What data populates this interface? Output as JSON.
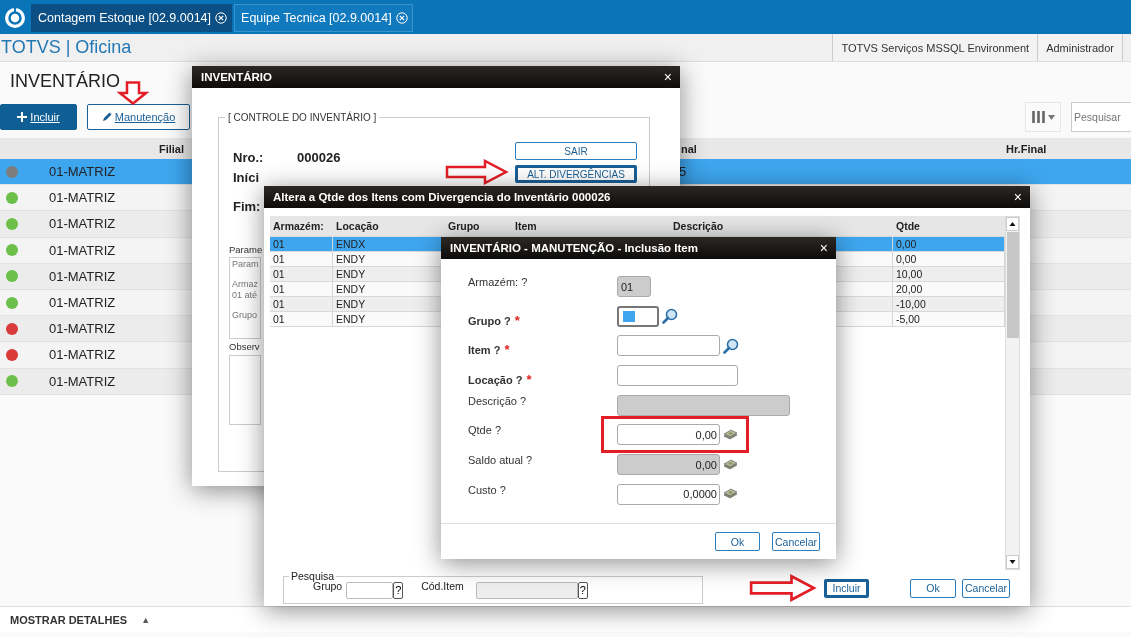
{
  "tabs": [
    {
      "label": "Contagem Estoque [02.9.0014]",
      "selected": true
    },
    {
      "label": "Equipe Tecnica [02.9.0014]",
      "selected": false
    }
  ],
  "app_title": "TOTVS | Oficina",
  "header_links": [
    "TOTVS Serviços MSSQL Environment",
    "Administrador"
  ],
  "page_title": "INVENTÁRIO",
  "toolbar": {
    "buttons": [
      {
        "label": "Incluir",
        "kind": "primary",
        "annotated": false
      },
      {
        "label": "Manutenção",
        "kind": "outline",
        "annotated": true
      }
    ],
    "search": {
      "placeholder": "Pesquisar"
    }
  },
  "table": {
    "columns": [
      "Filial",
      "nal",
      "Hr.Final"
    ],
    "rows": [
      {
        "filial": "01-MATRIZ",
        "column_3": "5",
        "color": "#7d7d7d",
        "selected": true
      },
      {
        "filial": "01-MATRIZ",
        "color": "#6cc04a",
        "selected": false
      },
      {
        "filial": "01-MATRIZ",
        "color": "#6cc04a",
        "selected": false
      },
      {
        "filial": "01-MATRIZ",
        "color": "#6cc04a",
        "selected": false
      },
      {
        "filial": "01-MATRIZ",
        "color": "#6cc04a",
        "selected": false
      },
      {
        "filial": "01-MATRIZ",
        "color": "#6cc04a",
        "selected": false
      },
      {
        "filial": "01-MATRIZ",
        "color": "#d93a3a",
        "selected": false
      },
      {
        "filial": "01-MATRIZ",
        "color": "#d93a3a",
        "selected": false
      },
      {
        "filial": "01-MATRIZ",
        "color": "#6cc04a",
        "selected": false
      }
    ]
  },
  "footer": {
    "label": "MOSTRAR DETALHES",
    "toggle": "▲"
  },
  "inventory_dialog": {
    "title": "INVENTÁRIO",
    "close": "×",
    "section": "[ CONTROLE DO INVENTÁRIO ]",
    "number_label": "Nro.:",
    "number": "000026",
    "start_label": "Iníci",
    "end_label": "Fim:",
    "buttons": [
      {
        "label": "SAIR",
        "annotated": false,
        "focused": false
      },
      {
        "label": "ALT. DIVERGÊNCIAS",
        "annotated": true,
        "focused": true
      }
    ],
    "params_label": "Parame",
    "params_lines": [
      "Param",
      "Armaz",
      "01 até",
      "Grupo"
    ],
    "notes_label": "Observ"
  },
  "divergence_dialog": {
    "title": "Altera a Qtde dos Itens com Divergencia do Inventário 000026",
    "close": "×",
    "columns": [
      "Armazém:",
      "Locação",
      "Grupo",
      "Item",
      "Descrição",
      "Qtde"
    ],
    "rows": [
      {
        "armazem": "01",
        "locacao": "ENDX",
        "qtde": "0,00",
        "selected": true
      },
      {
        "armazem": "01",
        "locacao": "ENDY",
        "qtde": "0,00",
        "selected": false
      },
      {
        "armazem": "01",
        "locacao": "ENDY",
        "qtde": "10,00",
        "selected": false
      },
      {
        "armazem": "01",
        "locacao": "ENDY",
        "qtde": "20,00",
        "selected": false
      },
      {
        "armazem": "01",
        "locacao": "ENDY",
        "qtde": "-10,00",
        "selected": false
      },
      {
        "armazem": "01",
        "locacao": "ENDY",
        "qtde": "-5,00",
        "selected": false
      }
    ],
    "search": {
      "legend": "Pesquisa",
      "group_label": "Grupo",
      "group_help": "?",
      "item_label": "Cód.Item",
      "item_help": "?"
    },
    "buttons": [
      {
        "label": "Incluir",
        "annotated": true,
        "focused": true
      },
      {
        "label": "Ok",
        "annotated": false,
        "focused": false
      },
      {
        "label": "Cancelar",
        "annotated": false,
        "focused": false
      }
    ]
  },
  "item_dialog": {
    "title": "INVENTÁRIO - MANUTENÇÃO - Inclusão Item",
    "close": "×",
    "fields": [
      {
        "label": "Armazém:  ?",
        "kind": "code",
        "disabled": true,
        "highlighted": false,
        "value": "01"
      },
      {
        "label": "Grupo ?",
        "kind": "group",
        "required_mark": "*",
        "disabled": false,
        "highlighted": false
      },
      {
        "label": "Item ?",
        "kind": "lookup",
        "required_mark": "*",
        "disabled": false,
        "highlighted": false
      },
      {
        "label": "Locação ?",
        "kind": "text",
        "required_mark": "*",
        "disabled": false,
        "highlighted": false
      },
      {
        "label": "Descrição ?",
        "kind": "wide",
        "disabled": true,
        "highlighted": false
      },
      {
        "label": "Qtde ?",
        "kind": "number",
        "disabled": false,
        "highlighted": true,
        "value": "0,00"
      },
      {
        "label": "Saldo atual ?",
        "kind": "number",
        "disabled": true,
        "highlighted": false,
        "value": "0,00"
      },
      {
        "label": "Custo ?",
        "kind": "number",
        "disabled": false,
        "highlighted": false,
        "value": "0,0000"
      }
    ],
    "buttons": [
      "Ok",
      "Cancelar"
    ]
  }
}
